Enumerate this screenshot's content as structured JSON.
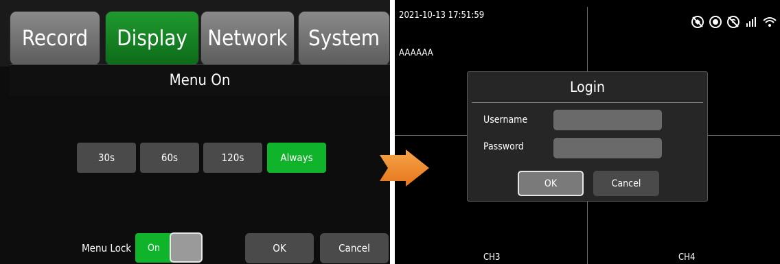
{
  "left": {
    "tabs": [
      {
        "label": "Record",
        "active": false
      },
      {
        "label": "Display",
        "active": true
      },
      {
        "label": "Network",
        "active": false
      },
      {
        "label": "System",
        "active": false
      }
    ],
    "section_title": "Menu On",
    "options": [
      {
        "label": "30s",
        "selected": false
      },
      {
        "label": "60s",
        "selected": false
      },
      {
        "label": "120s",
        "selected": false
      },
      {
        "label": "Always",
        "selected": true
      }
    ],
    "menu_lock": {
      "label": "Menu Lock",
      "toggle_label": "On",
      "state": "on"
    },
    "ok_label": "OK",
    "cancel_label": "Cancel"
  },
  "right": {
    "timestamp": "2021-10-13 17:51:59",
    "device_name": "AAAAAA",
    "status_icons": [
      "no-gps-icon",
      "record-icon",
      "no-signal-icon",
      "cellular-signal-icon",
      "wifi-icon"
    ],
    "channels": {
      "ch3": "CH3",
      "ch4": "CH4"
    },
    "login": {
      "title": "Login",
      "username_label": "Username",
      "password_label": "Password",
      "username_value": "",
      "password_value": "",
      "ok_label": "OK",
      "cancel_label": "Cancel"
    }
  },
  "colors": {
    "active_green": "#0fb42b",
    "arrow_orange": "#f08a2a"
  }
}
